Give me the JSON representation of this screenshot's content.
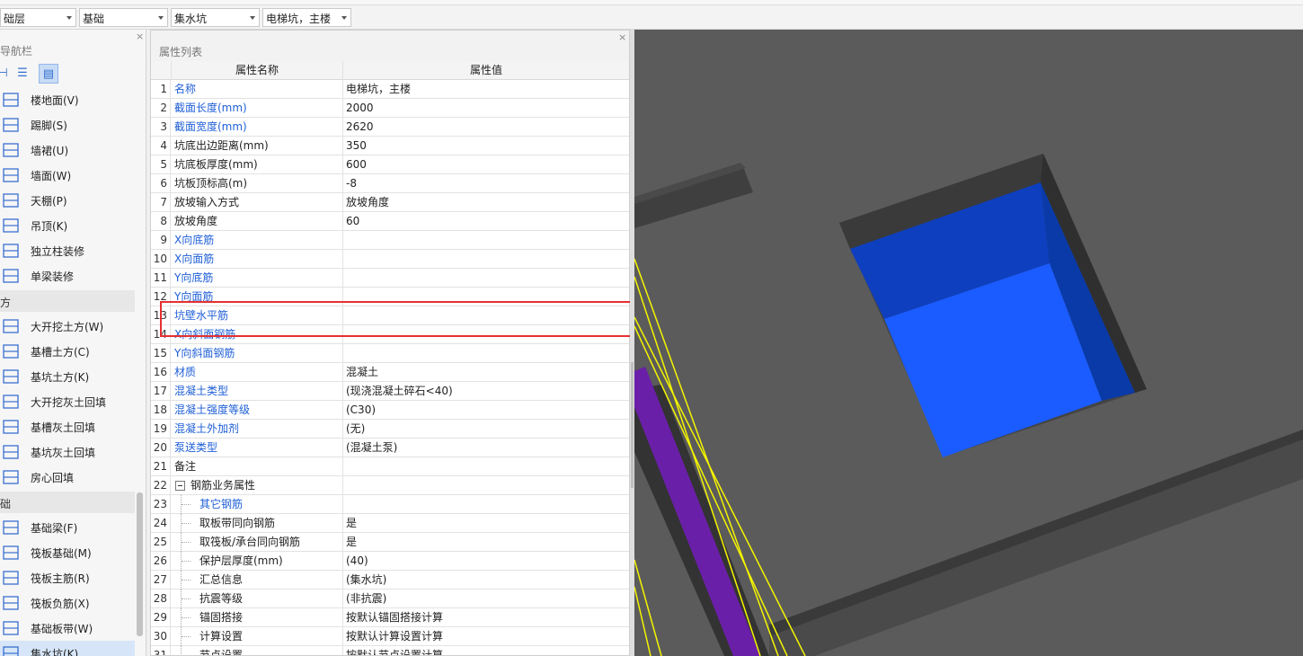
{
  "toolbar": {
    "floor_combo": "础层",
    "type_combo": "基础",
    "component_combo": "集水坑",
    "instance_combo": "电梯坑，主楼"
  },
  "nav": {
    "title": "导航栏",
    "sections": [
      {
        "items": [
          {
            "label": "楼地面(V)",
            "icon": "floor-icon"
          },
          {
            "label": "踢脚(S)",
            "icon": "skirting-icon"
          },
          {
            "label": "墙裙(U)",
            "icon": "wainscot-icon"
          },
          {
            "label": "墙面(W)",
            "icon": "wall-surface-icon"
          },
          {
            "label": "天棚(P)",
            "icon": "ceiling-icon"
          },
          {
            "label": "吊顶(K)",
            "icon": "suspended-ceiling-icon"
          },
          {
            "label": "独立柱装修",
            "icon": "column-finish-icon"
          },
          {
            "label": "单梁装修",
            "icon": "beam-finish-icon"
          }
        ]
      },
      {
        "group": "方",
        "items": [
          {
            "label": "大开挖土方(W)",
            "icon": "excavation-icon"
          },
          {
            "label": "基槽土方(C)",
            "icon": "trench-icon"
          },
          {
            "label": "基坑土方(K)",
            "icon": "pit-icon"
          },
          {
            "label": "大开挖灰土回填",
            "icon": "backfill-icon"
          },
          {
            "label": "基槽灰土回填",
            "icon": "trench-backfill-icon"
          },
          {
            "label": "基坑灰土回填",
            "icon": "pit-backfill-icon"
          },
          {
            "label": "房心回填",
            "icon": "room-backfill-icon"
          }
        ]
      },
      {
        "group": "础",
        "items": [
          {
            "label": "基础梁(F)",
            "icon": "foundation-beam-icon"
          },
          {
            "label": "筏板基础(M)",
            "icon": "raft-icon"
          },
          {
            "label": "筏板主筋(R)",
            "icon": "raft-main-rebar-icon"
          },
          {
            "label": "筏板负筋(X)",
            "icon": "raft-neg-rebar-icon"
          },
          {
            "label": "基础板带(W)",
            "icon": "slab-strip-icon"
          },
          {
            "label": "集水坑(K)",
            "icon": "sump-icon",
            "selected": true
          }
        ]
      }
    ]
  },
  "props": {
    "title": "属性列表",
    "col_name": "属性名称",
    "col_value": "属性值",
    "rows": [
      {
        "n": "1",
        "name": "名称",
        "value": "电梯坑，主楼",
        "blue": true
      },
      {
        "n": "2",
        "name": "截面长度(mm)",
        "value": "2000",
        "blue": true
      },
      {
        "n": "3",
        "name": "截面宽度(mm)",
        "value": "2620",
        "blue": true
      },
      {
        "n": "4",
        "name": "坑底出边距离(mm)",
        "value": "350"
      },
      {
        "n": "5",
        "name": "坑底板厚度(mm)",
        "value": "600"
      },
      {
        "n": "6",
        "name": "坑板顶标高(m)",
        "value": "-8"
      },
      {
        "n": "7",
        "name": "放坡输入方式",
        "value": "放坡角度"
      },
      {
        "n": "8",
        "name": "放坡角度",
        "value": "60"
      },
      {
        "n": "9",
        "name": "X向底筋",
        "value": "",
        "blue": true
      },
      {
        "n": "10",
        "name": "X向面筋",
        "value": "",
        "blue": true
      },
      {
        "n": "11",
        "name": "Y向底筋",
        "value": "",
        "blue": true
      },
      {
        "n": "12",
        "name": "Y向面筋",
        "value": "",
        "blue": true
      },
      {
        "n": "13",
        "name": "坑壁水平筋",
        "value": "",
        "blue": true
      },
      {
        "n": "14",
        "name": "X向斜面钢筋",
        "value": "",
        "blue": true
      },
      {
        "n": "15",
        "name": "Y向斜面钢筋",
        "value": "",
        "blue": true
      },
      {
        "n": "16",
        "name": "材质",
        "value": "混凝土",
        "blue": true
      },
      {
        "n": "17",
        "name": "混凝土类型",
        "value": "(现浇混凝土碎石<40)",
        "blue": true
      },
      {
        "n": "18",
        "name": "混凝土强度等级",
        "value": "(C30)",
        "blue": true
      },
      {
        "n": "19",
        "name": "混凝土外加剂",
        "value": "(无)",
        "blue": true
      },
      {
        "n": "20",
        "name": "泵送类型",
        "value": "(混凝土泵)",
        "blue": true
      },
      {
        "n": "21",
        "name": "备注",
        "value": ""
      },
      {
        "n": "22",
        "name": "钢筋业务属性",
        "value": "",
        "group": true
      },
      {
        "n": "23",
        "name": "其它钢筋",
        "value": "",
        "blue": true,
        "child": true
      },
      {
        "n": "24",
        "name": "取板带同向钢筋",
        "value": "是",
        "child": true
      },
      {
        "n": "25",
        "name": "取筏板/承台同向钢筋",
        "value": "是",
        "child": true
      },
      {
        "n": "26",
        "name": "保护层厚度(mm)",
        "value": "(40)",
        "child": true
      },
      {
        "n": "27",
        "name": "汇总信息",
        "value": "(集水坑)",
        "child": true
      },
      {
        "n": "28",
        "name": "抗震等级",
        "value": "(非抗震)",
        "child": true
      },
      {
        "n": "29",
        "name": "锚固搭接",
        "value": "按默认锚固搭接计算",
        "child": true
      },
      {
        "n": "30",
        "name": "计算设置",
        "value": "按默认计算设置计算",
        "child": true
      },
      {
        "n": "31",
        "name": "节点设置",
        "value": "按默认节点设置计算",
        "child": true
      }
    ]
  },
  "colors": {
    "viewport_bg": "#5b5b5b",
    "pit_blue": "#1a5cff",
    "beam_purple": "#6a1fa8",
    "outline_yellow": "#f5f500",
    "highlight_red": "#e53030"
  }
}
